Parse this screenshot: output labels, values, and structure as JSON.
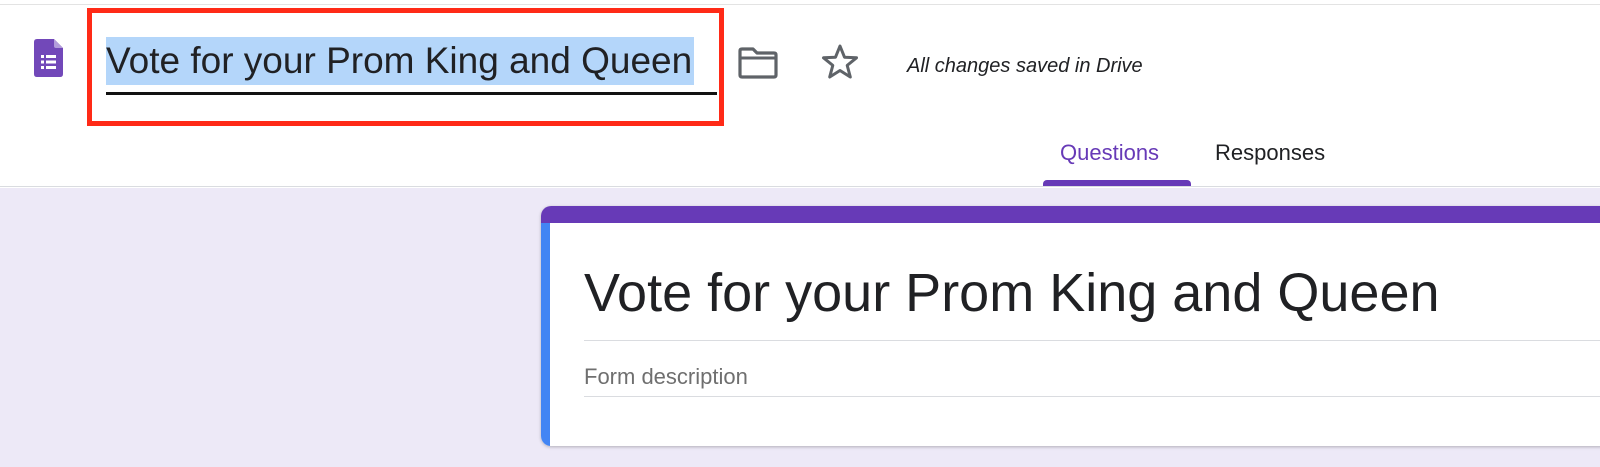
{
  "header": {
    "document_title": "Vote for your Prom King and Queen",
    "save_status": "All changes saved in Drive",
    "icons": {
      "app": "google-forms-icon",
      "folder": "folder-icon",
      "star": "star-icon"
    }
  },
  "tabs": [
    {
      "label": "Questions",
      "active": true
    },
    {
      "label": "Responses",
      "active": false
    }
  ],
  "form": {
    "title": "Vote for your Prom King and Queen",
    "description_placeholder": "Form description"
  },
  "colors": {
    "accent": "#673ab7",
    "card_left_accent": "#4285f4",
    "background": "#ede9f7",
    "selection": "#b4d6fa",
    "highlight_box": "#ff2a17"
  }
}
